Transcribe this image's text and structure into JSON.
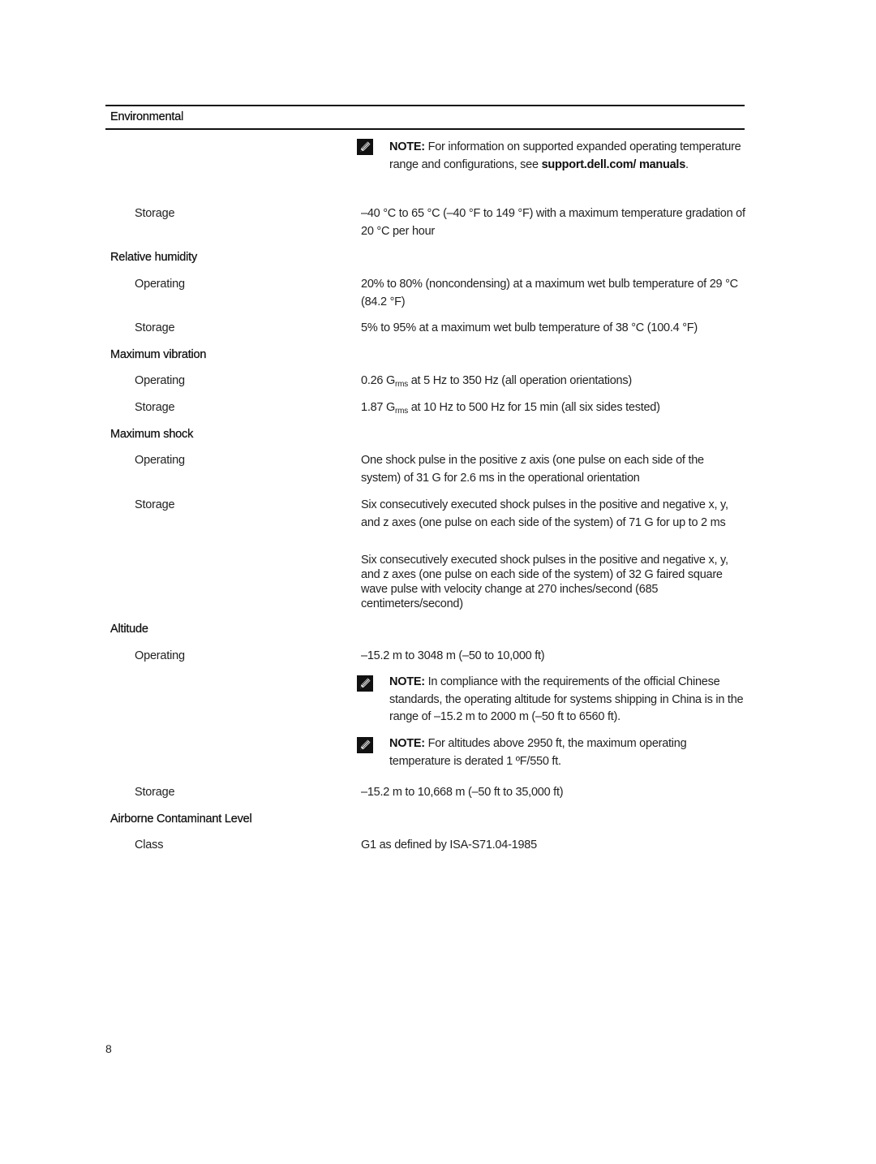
{
  "table": {
    "header": "Environmental",
    "note_top": {
      "icon": "pencil-note-icon",
      "label": "NOTE:",
      "text_before_link": " For information on supported expanded operating temperature range and configurations, see ",
      "link": "support.dell.com/ manuals",
      "text_after_link": "."
    },
    "temperature_storage": {
      "label": "Storage",
      "value": "–40 °C to 65 °C (–40 °F to 149 °F) with a maximum temperature gradation of 20 °C per hour"
    },
    "relative_humidity": {
      "title": "Relative humidity",
      "operating_label": "Operating",
      "operating_value": "20% to 80% (noncondensing) at a maximum wet bulb temperature of 29 °C (84.2 °F)",
      "storage_label": "Storage",
      "storage_value": "5% to 95% at a maximum wet bulb temperature of 38 °C (100.4 °F)"
    },
    "maximum_vibration": {
      "title": "Maximum vibration",
      "operating_label": "Operating",
      "operating_value_pre": "0.26 G",
      "operating_value_sub": "rms",
      "operating_value_post": " at 5 Hz to 350 Hz (all operation orientations)",
      "storage_label": "Storage",
      "storage_value_pre": "1.87 G",
      "storage_value_sub": "rms",
      "storage_value_post": " at 10 Hz to 500 Hz for 15 min (all six sides tested)"
    },
    "maximum_shock": {
      "title": "Maximum shock",
      "operating_label": "Operating",
      "operating_value": "One shock pulse in the positive z axis (one pulse on each side of the system) of 31 G for 2.6 ms in the operational orientation",
      "storage_label": "Storage",
      "storage_value_1": "Six consecutively executed shock pulses in the positive and negative x, y, and z axes (one pulse on each side of the system) of 71 G for up to 2 ms",
      "storage_value_2": "Six consecutively executed shock pulses in the positive and negative x, y, and z axes (one pulse on each side of the system) of 32 G faired square wave pulse with velocity change at 270 inches/second (685 centimeters/second)"
    },
    "altitude": {
      "title": "Altitude",
      "operating_label": "Operating",
      "operating_value": "–15.2 m to 3048 m (–50 to 10,000 ft)",
      "note_china": {
        "icon": "pencil-note-icon",
        "label": "NOTE:",
        "text": " In compliance with the requirements of the official Chinese standards, the operating altitude for systems shipping in China is in the range of –15.2 m to 2000 m (–50 ft to 6560 ft)."
      },
      "note_derate": {
        "icon": "pencil-note-icon",
        "label": "NOTE:",
        "text": " For altitudes above 2950 ft, the maximum operating temperature is derated 1 ºF/550 ft."
      },
      "storage_label": "Storage",
      "storage_value": "–15.2 m to 10,668 m (–50 ft to 35,000 ft)"
    },
    "airborne_contaminant": {
      "title": "Airborne Contaminant Level",
      "class_label": "Class",
      "class_value": "G1 as defined by ISA-S71.04-1985"
    }
  },
  "footer": {
    "page_number": "8"
  }
}
